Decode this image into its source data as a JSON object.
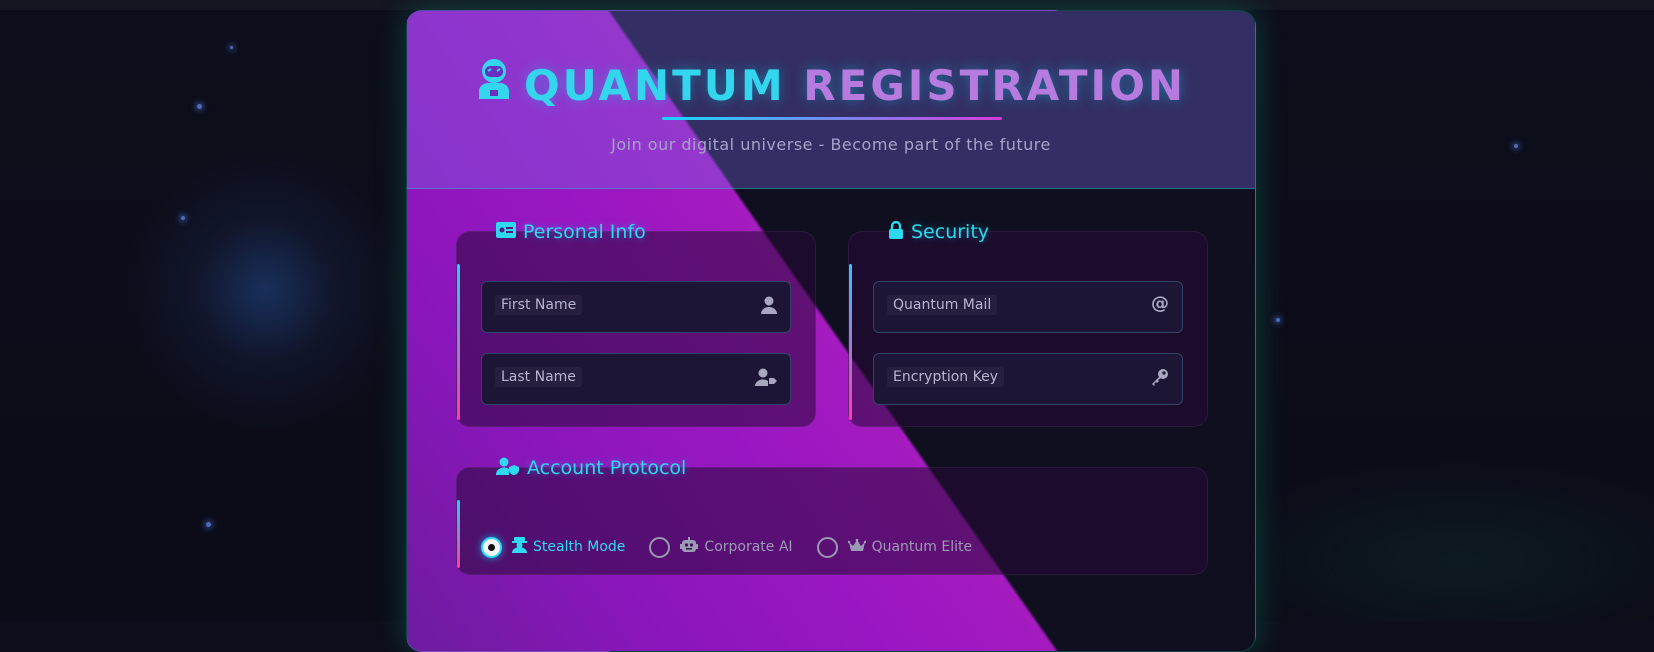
{
  "header": {
    "title_part1": "QUANTUM",
    "title_part2": "REGISTRATION",
    "subtitle": "Join our digital universe - Become part of the future"
  },
  "sections": {
    "personal": {
      "legend": "Personal Info",
      "first_name_placeholder": "First Name",
      "last_name_placeholder": "Last Name"
    },
    "security": {
      "legend": "Security",
      "email_placeholder": "Quantum Mail",
      "password_placeholder": "Encryption Key"
    },
    "account": {
      "legend": "Account Protocol",
      "options": [
        {
          "label": "Stealth Mode",
          "selected": true,
          "icon": "user-secret-icon"
        },
        {
          "label": "Corporate AI",
          "selected": false,
          "icon": "robot-icon"
        },
        {
          "label": "Quantum Elite",
          "selected": false,
          "icon": "crown-icon"
        }
      ]
    }
  },
  "colors": {
    "accent_cyan": "#2ed8ee",
    "accent_magenta": "#d33dd8",
    "background": "#0d0e1b"
  }
}
